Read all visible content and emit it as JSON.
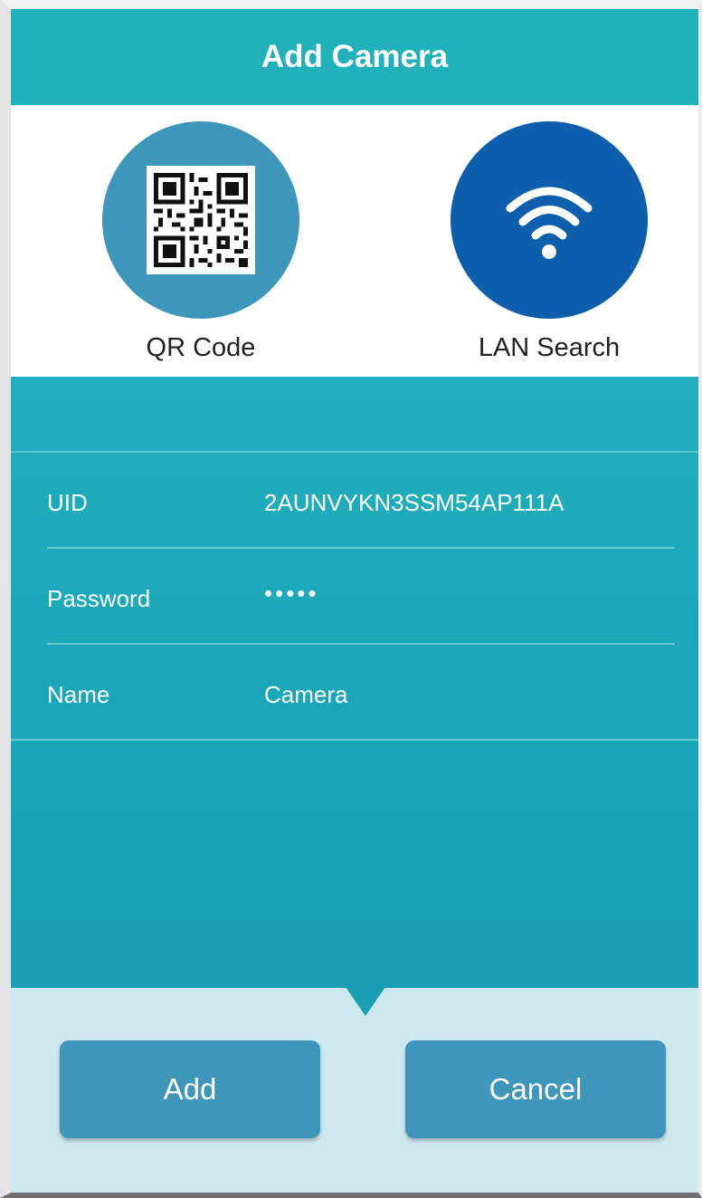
{
  "header": {
    "title": "Add Camera"
  },
  "methods": {
    "qr": {
      "label": "QR Code",
      "icon": "qr-code-icon"
    },
    "lan": {
      "label": "LAN Search",
      "icon": "wifi-icon"
    }
  },
  "form": {
    "uid": {
      "label": "UID",
      "value": "2AUNVYKN3SSM54AP111A"
    },
    "password": {
      "label": "Password",
      "value": "•••••"
    },
    "name": {
      "label": "Name",
      "value": "Camera"
    }
  },
  "actions": {
    "add_label": "Add",
    "cancel_label": "Cancel"
  },
  "colors": {
    "header": "#21b1ba",
    "qr_circle": "#3e96bb",
    "lan_circle": "#0d5fae",
    "panel": "#1ba8b9",
    "footer": "#cfe8f0",
    "button": "#3e97bb"
  }
}
